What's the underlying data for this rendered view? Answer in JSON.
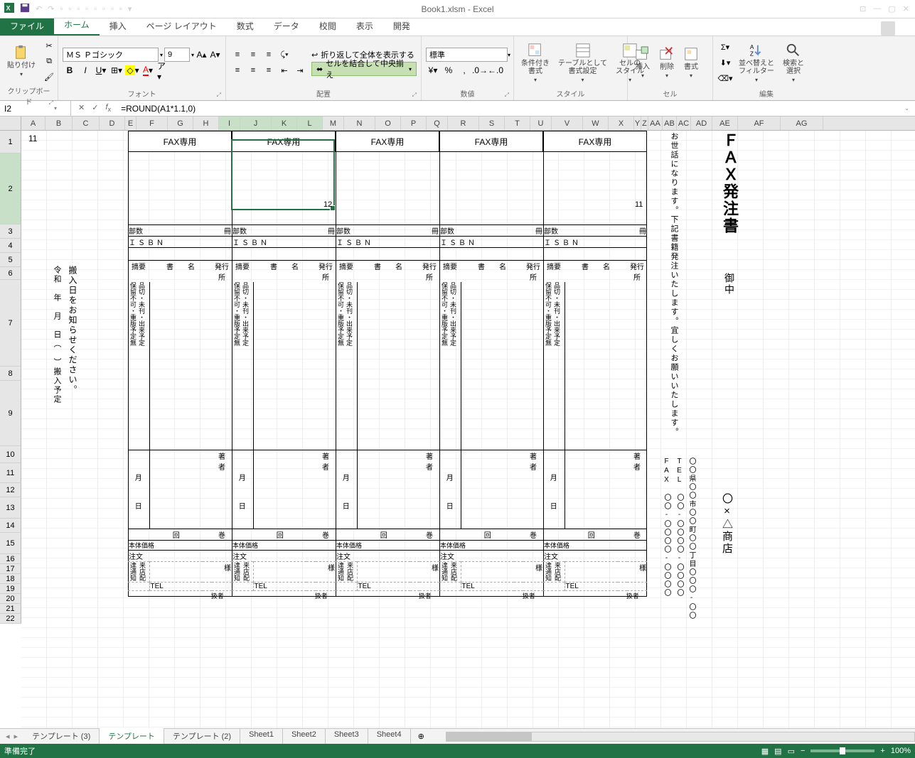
{
  "app": {
    "title": "Book1.xlsm - Excel"
  },
  "ribbon": {
    "file": "ファイル",
    "tabs": [
      "ホーム",
      "挿入",
      "ページ レイアウト",
      "数式",
      "データ",
      "校閲",
      "表示",
      "開発"
    ],
    "active_tab": "ホーム",
    "groups": {
      "clipboard": {
        "label": "クリップボード",
        "paste": "貼り付け"
      },
      "font": {
        "label": "フォント",
        "name": "ＭＳ Ｐゴシック",
        "size": "9"
      },
      "alignment": {
        "label": "配置",
        "wrap": "折り返して全体を表示する",
        "merge": "セルを結合して中央揃え"
      },
      "number": {
        "label": "数値",
        "format": "標準"
      },
      "styles": {
        "label": "スタイル",
        "cond": "条件付き\n書式",
        "table": "テーブルとして\n書式設定",
        "cell": "セルの\nスタイル"
      },
      "cells": {
        "label": "セル",
        "insert": "挿入",
        "delete": "削除",
        "format": "書式"
      },
      "editing": {
        "label": "編集",
        "sort": "並べ替えと\nフィルター",
        "find": "検索と\n選択"
      }
    }
  },
  "formula": {
    "cell_ref": "I2",
    "formula": "=ROUND(A1*1.1,0)"
  },
  "cols": [
    "A",
    "B",
    "C",
    "D",
    "E",
    "F",
    "G",
    "H",
    "I",
    "J",
    "K",
    "L",
    "M",
    "N",
    "O",
    "P",
    "Q",
    "R",
    "S",
    "T",
    "U",
    "V",
    "W",
    "X",
    "Y",
    "Z",
    "AA",
    "AB",
    "AC",
    "AD",
    "AE",
    "AF",
    "AG"
  ],
  "selected_cols": [
    "I",
    "J",
    "K",
    "L"
  ],
  "rows_shown": 22,
  "cells": {
    "A1": "11",
    "L2": "12",
    "X2": "11"
  },
  "fax_form": {
    "fax_only": "FAX専用",
    "busuu": "部数",
    "satsu": "冊",
    "isbn": "ＩＳＢＮ",
    "tekiyou": "摘要",
    "shomei": "書　　名",
    "hakkousho": "発行所",
    "tekiyou_opts": "保留不可・重版予定無",
    "hinkire": "品切・未刊・出来予定",
    "chosha": "著　者",
    "month": "月",
    "day": "日",
    "kai": "回",
    "kan": "巻",
    "hontai": "本体価格",
    "chuumon": "注文",
    "raiten": "来店配達通知",
    "sama": "様",
    "tel": "TEL",
    "atsukai": "扱者"
  },
  "right_panel": {
    "title": "ＦＡＸ発注書",
    "onchuu": "御中",
    "msg": "お世話になります。下記書籍発注いたします。宜しくお願いいたします。",
    "shop": "〇×△商店",
    "addr": "〇〇県〇〇市〇〇町〇〇丁目〇〇〇-〇〇",
    "tel_label": "TEL",
    "tel": "〇〇-〇〇〇〇-〇〇〇〇",
    "fax_label": "FAX",
    "fax": "〇〇-〇〇〇〇-〇〇〇〇"
  },
  "left_note": {
    "reiwa": "令和　年　月　日（　）搬入予定",
    "hannyuu": "搬入日をお知らせください。"
  },
  "sheet_tabs": [
    "テンプレート (3)",
    "テンプレート",
    "テンプレート (2)",
    "Sheet1",
    "Sheet2",
    "Sheet3",
    "Sheet4"
  ],
  "active_sheet": "テンプレート",
  "status": {
    "ready": "準備完了",
    "zoom": "100%"
  }
}
